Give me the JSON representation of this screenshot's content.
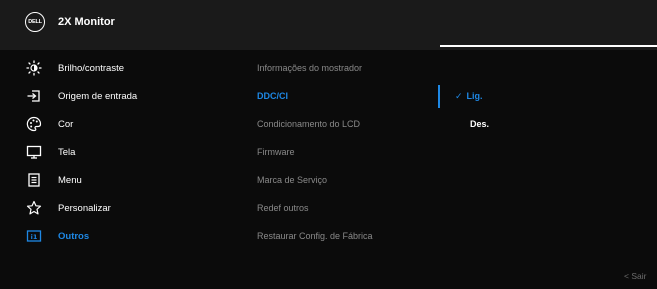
{
  "header": {
    "logo_text": "DELL",
    "title": "2X Monitor"
  },
  "menu": [
    {
      "label": "Brilho/contraste",
      "icon": "sun-icon"
    },
    {
      "label": "Origem de entrada",
      "icon": "input-source-icon"
    },
    {
      "label": "Cor",
      "icon": "palette-icon"
    },
    {
      "label": "Tela",
      "icon": "display-icon"
    },
    {
      "label": "Menu",
      "icon": "menu-list-icon"
    },
    {
      "label": "Personalizar",
      "icon": "star-icon"
    },
    {
      "label": "Outros",
      "icon": "others-icon",
      "active": true
    }
  ],
  "submenu": [
    {
      "label": "Informações do mostrador"
    },
    {
      "label": "DDC/CI",
      "active": true
    },
    {
      "label": "Condicionamento do LCD"
    },
    {
      "label": "Firmware"
    },
    {
      "label": "Marca de Serviço"
    },
    {
      "label": "Redef outros"
    },
    {
      "label": "Restaurar Config. de Fábrica"
    }
  ],
  "options": {
    "check": "✓",
    "on": "Lig.",
    "off": "Des."
  },
  "footer": {
    "exit": "< Sair"
  },
  "colors": {
    "accent": "#1e88e5",
    "background": "#0b0b0b",
    "header": "#1a1a1a",
    "muted_text": "#8a8a8a"
  }
}
